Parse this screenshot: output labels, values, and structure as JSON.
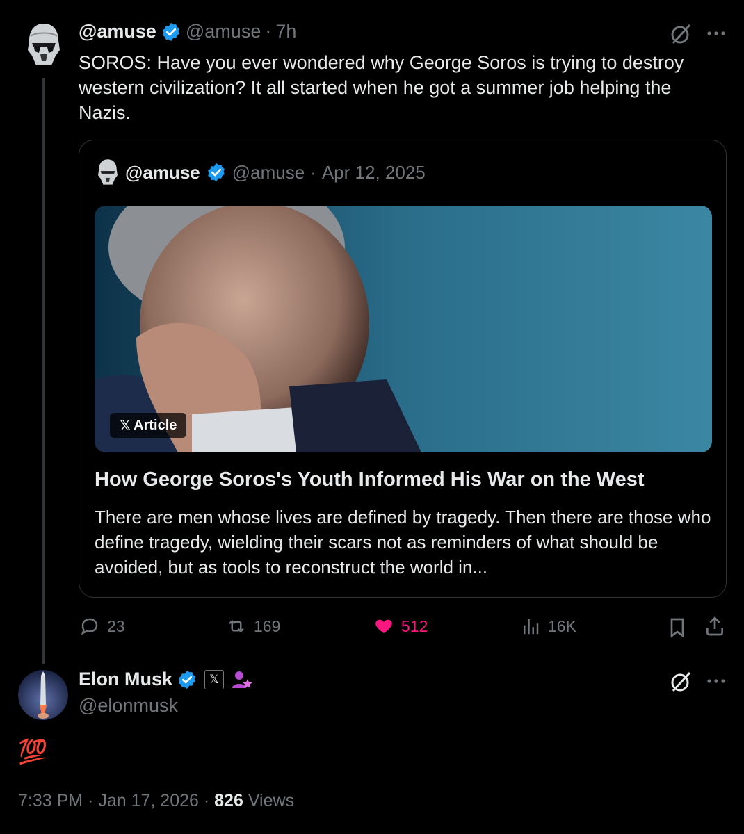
{
  "main_tweet": {
    "display_name": "@amuse",
    "handle": "@amuse",
    "time": "7h",
    "text": "SOROS: Have you ever wondered why George Soros is trying to destroy western civilization? It all started when he got a summer job helping the Nazis.",
    "quote": {
      "display_name": "@amuse",
      "handle": "@amuse",
      "date": "Apr 12, 2025",
      "badge_label": "Article",
      "title": "How George Soros's Youth Informed His War on the West",
      "description": "There are men whose lives are defined by tragedy. Then there are those who define tragedy, wielding their scars not as reminders of what should be avoided, but as tools to reconstruct the world in..."
    },
    "actions": {
      "replies": "23",
      "reposts": "169",
      "likes": "512",
      "views": "16K"
    }
  },
  "reply_tweet": {
    "display_name": "Elon Musk",
    "handle": "@elonmusk",
    "emoji": "💯",
    "time": "7:33 PM",
    "date": "Jan 17, 2026",
    "views_count": "826",
    "views_label": "Views"
  },
  "colors": {
    "background": "#000000",
    "text": "#e7e9ea",
    "muted": "#71767b",
    "verified": "#1d9bf0",
    "like": "#f91880",
    "border": "#2f3336"
  }
}
